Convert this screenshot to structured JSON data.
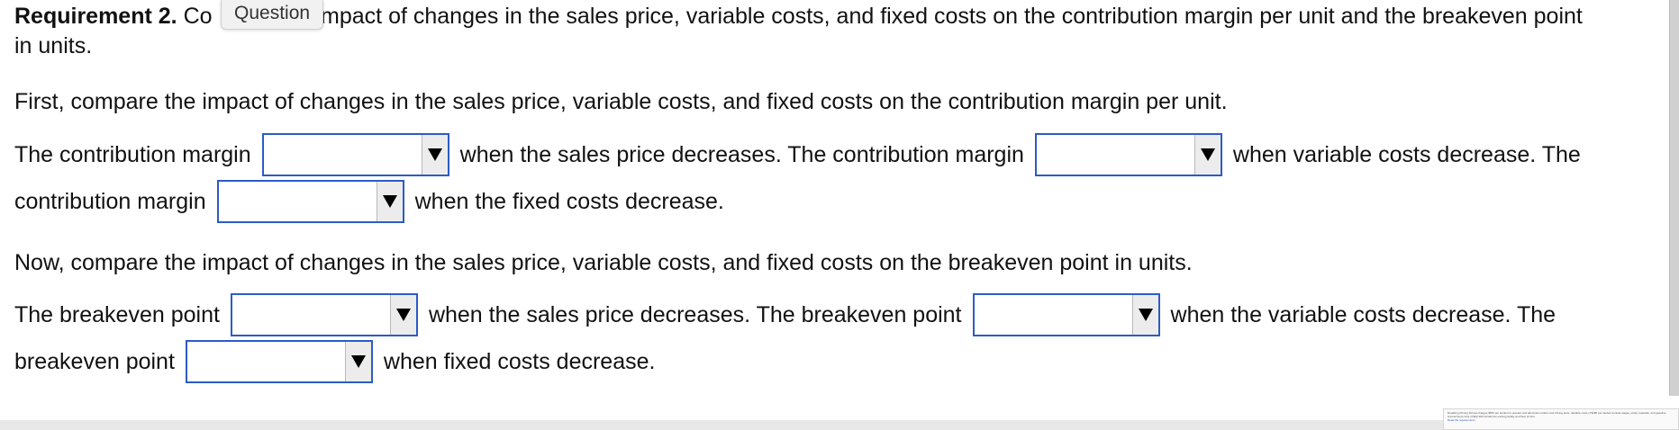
{
  "requirement": {
    "label": "Requirement 2.",
    "text_start": "Co",
    "text_rest": "impact of changes in the sales price, variable costs, and fixed costs on the contribution margin per unit and the breakeven point",
    "text_line2": "in units."
  },
  "tooltip": "Question",
  "section1": {
    "intro": "First, compare the impact of changes in the sales price, variable costs, and fixed costs on the contribution margin per unit.",
    "line1_a": "The contribution margin",
    "line1_b": "when the sales price decreases. The contribution margin",
    "line1_c": "when variable costs decrease. The",
    "line2_a": "contribution margin",
    "line2_b": "when the fixed costs decrease."
  },
  "section2": {
    "intro": "Now, compare the impact of changes in the sales price, variable costs, and fixed costs on the breakeven point in units.",
    "line1_a": "The breakeven point",
    "line1_b": "when the sales price decreases. The breakeven point",
    "line1_c": "when the variable costs decrease. The",
    "line2_a": "breakeven point",
    "line2_b": "when fixed costs decrease."
  },
  "dropdowns": {
    "cm_sales_price": "",
    "cm_variable_costs": "",
    "cm_fixed_costs": "",
    "be_sales_price": "",
    "be_variable_costs": "",
    "be_fixed_costs": ""
  },
  "thumbnail": {
    "text": "Roadking Driving School charges $560 per student to prepare and administer written and driving tests. Variable costs of $280 per student include wages, study materials, and gasoline. Annual fixed costs of $92,400 include the training facility and fleet of cars.",
    "link": "Read the requirements"
  },
  "colors": {
    "dropdown_border": "#2c5bc7",
    "text": "#111111"
  }
}
